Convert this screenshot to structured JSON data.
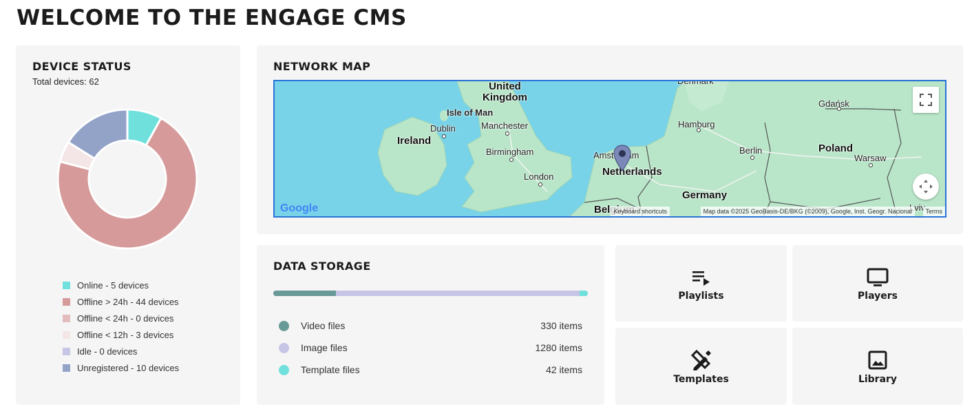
{
  "page": {
    "title": "WELCOME TO THE ENGAGE CMS"
  },
  "device_status": {
    "title": "DEVICE STATUS",
    "total": "Total devices: 62",
    "segments": [
      {
        "label": "Online - 5 devices",
        "value": 5,
        "color": "#6fe0dc"
      },
      {
        "label": "Offline > 24h - 44 devices",
        "value": 44,
        "color": "#d69a9a"
      },
      {
        "label": "Offline < 24h - 0 devices",
        "value": 0,
        "color": "#e3bdbd"
      },
      {
        "label": "Offline < 12h - 3 devices",
        "value": 3,
        "color": "#f4e6e6"
      },
      {
        "label": "Idle - 0 devices",
        "value": 0,
        "color": "#c6c5e6"
      },
      {
        "label": "Unregistered - 10 devices",
        "value": 10,
        "color": "#93a3c8"
      }
    ]
  },
  "network_map": {
    "title": "NETWORK MAP",
    "labels": {
      "united_kingdom": "United\nKingdom",
      "isle_of_man": "Isle of Man",
      "dublin": "Dublin",
      "ireland": "Ireland",
      "manchester": "Manchester",
      "birmingham": "Birmingham",
      "london": "London",
      "amsterdam": "Amsterdam",
      "netherlands": "Netherlands",
      "belgium": "Belgium",
      "hamburg": "Hamburg",
      "germany": "Germany",
      "berlin": "Berlin",
      "poland": "Poland",
      "warsaw": "Warsaw",
      "gdansk": "Gdańsk",
      "denmark": "Denmark",
      "lviv": "Lviv"
    },
    "google": "Google",
    "keyboard_shortcuts": "Keyboard shortcuts",
    "map_data": "Map data ©2025 GeoBasis-DE/BKG (©2009), Google, Inst. Geogr. Nacional",
    "terms": "Terms",
    "fullscreen_icon": "fullscreen-icon",
    "compass_icon": "camera-control-icon"
  },
  "data_storage": {
    "title": "DATA STORAGE",
    "items": [
      {
        "label": "Video files",
        "count": "330 items",
        "value": 330,
        "color": "#6a9a97"
      },
      {
        "label": "Image files",
        "count": "1280 items",
        "value": 1280,
        "color": "#c6c5e6"
      },
      {
        "label": "Template files",
        "count": "42 items",
        "value": 42,
        "color": "#6fe0dc"
      }
    ]
  },
  "tiles": {
    "playlists": {
      "label": "Playlists",
      "icon": "playlist-play-icon"
    },
    "players": {
      "label": "Players",
      "icon": "monitor-icon"
    },
    "templates": {
      "label": "Templates",
      "icon": "design-tools-icon"
    },
    "library": {
      "label": "Library",
      "icon": "image-icon"
    }
  }
}
